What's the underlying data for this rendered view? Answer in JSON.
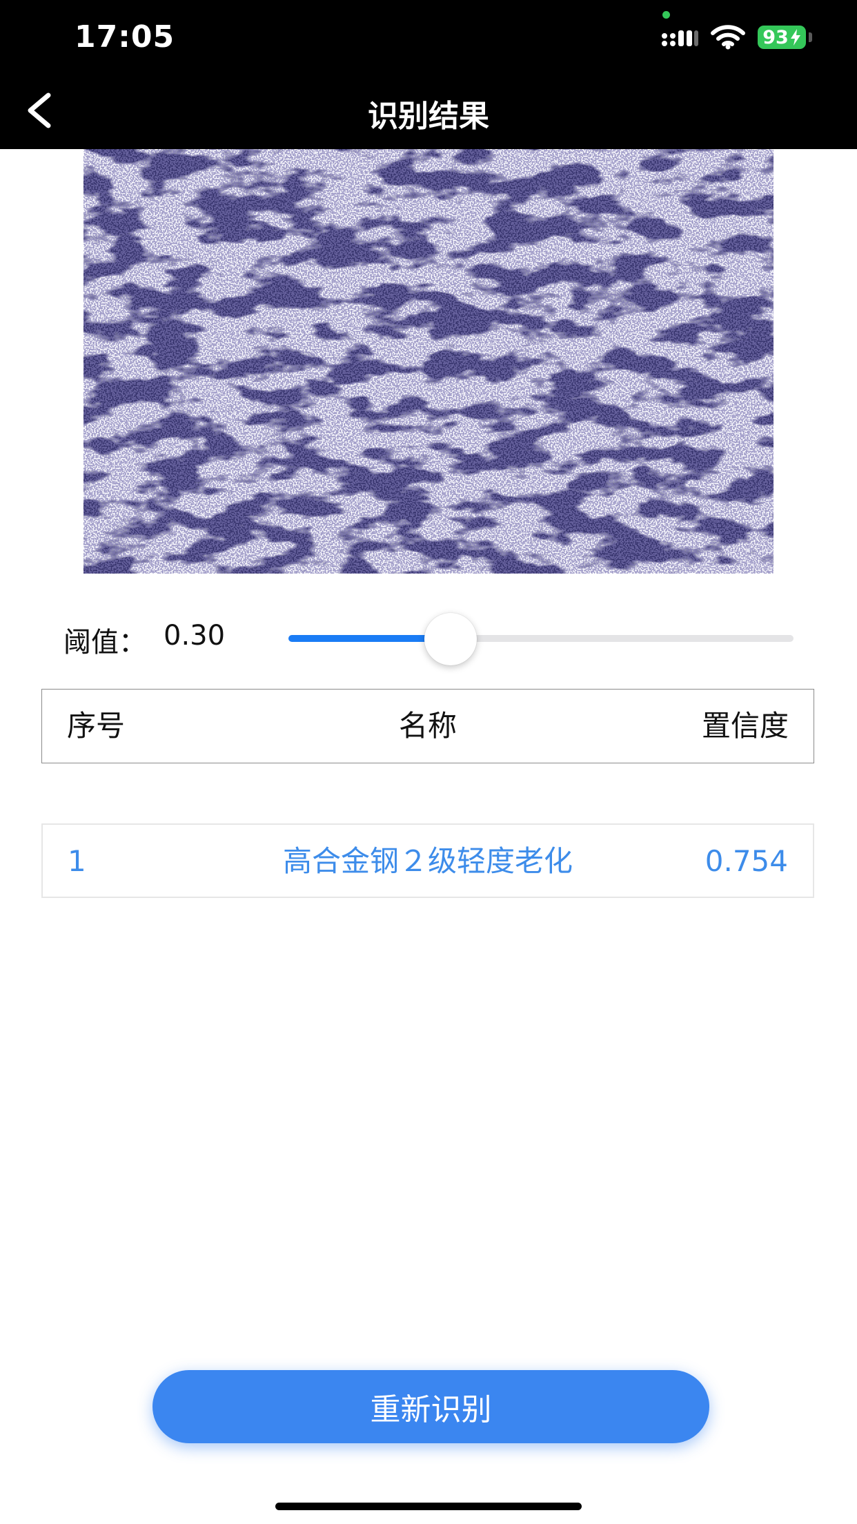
{
  "status_bar": {
    "time": "17:05",
    "battery": "93",
    "icons": [
      "privacy-dot",
      "signal-icon",
      "wifi-icon",
      "battery-charging-icon"
    ]
  },
  "nav": {
    "title": "识别结果",
    "back_icon": "chevron-left-icon"
  },
  "threshold": {
    "label": "阈值：",
    "value_text": "0.30",
    "value": 0.3
  },
  "table": {
    "headers": [
      "序号",
      "名称",
      "置信度"
    ],
    "rows": [
      {
        "index": "1",
        "name": "高合金钢２级轻度老化",
        "confidence": "0.754"
      }
    ]
  },
  "actions": {
    "retry_label": "重新识别"
  },
  "colors": {
    "accent": "#3b86f0",
    "slider_fill": "#1a7cf5",
    "row_text": "#3d8cea",
    "status_green": "#34c759",
    "topbar": "#000000"
  }
}
